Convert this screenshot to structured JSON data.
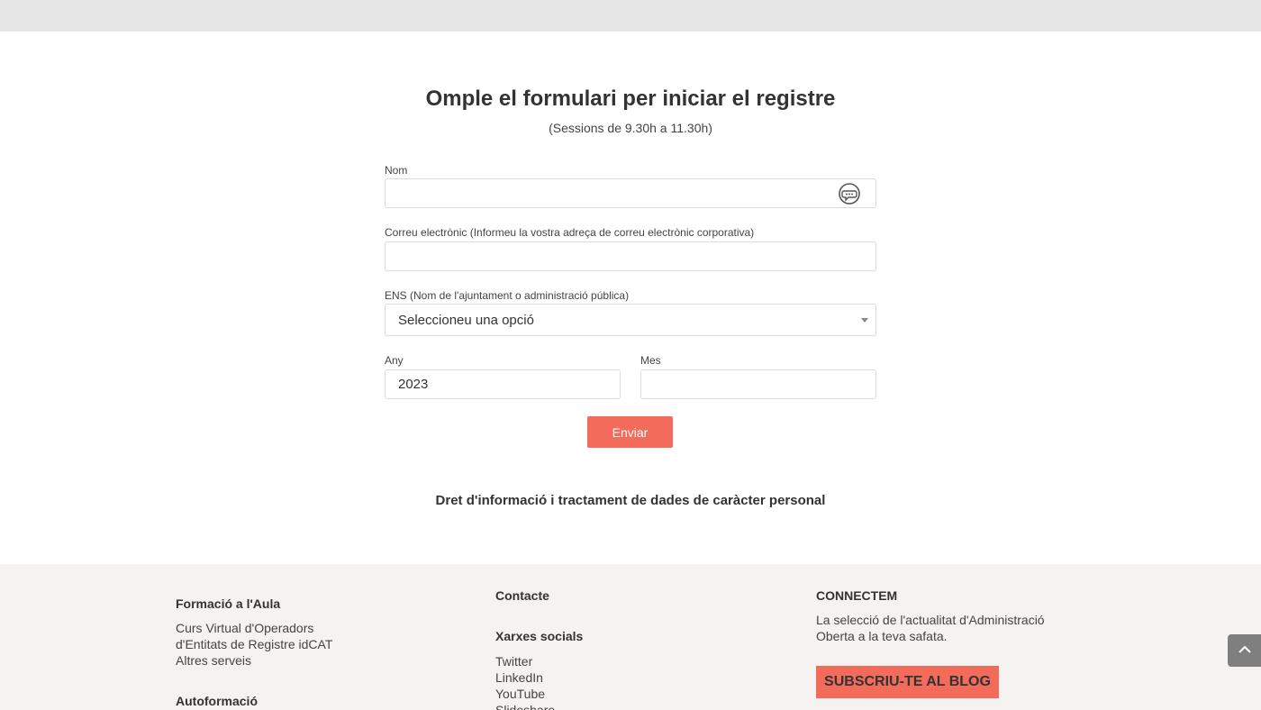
{
  "form": {
    "title": "Omple el formulari per iniciar el registre",
    "subtitle": "(Sessions de 9.30h a 11.30h)",
    "name_label": "Nom",
    "name_value": "",
    "email_label": "Correu electrònic (Informeu la vostra adreça de correu electrònic corporativa)",
    "email_value": "",
    "ens_label": "ENS (Nom de l'ajuntament o administració pública)",
    "ens_selected": "Seleccioneu una opció",
    "year_label": "Any",
    "year_value": "2023",
    "month_label": "Mes",
    "month_value": "",
    "submit_label": "Enviar"
  },
  "privacy_link": "Dret d'informació i tractament de dades de caràcter personal",
  "footer": {
    "col1": {
      "heading": "Formació a l'Aula",
      "links": [
        "Curs Virtual d'Operadors",
        "d'Entitats de Registre idCAT",
        "Altres serveis"
      ],
      "heading2": "Autoformació"
    },
    "col2": {
      "heading": "Contacte",
      "social_heading": "Xarxes socials",
      "links": [
        "Twitter",
        "LinkedIn",
        "YouTube",
        "Slideshare"
      ]
    },
    "col3": {
      "heading": "CONNECTEM",
      "text_line1": "La selecció de l'actualitat d'Administració",
      "text_line2": "Oberta a la teva safata.",
      "cta": "SUBSCRIU-TE AL BLOG"
    }
  },
  "icons": {
    "chat": "chat-bubble-icon",
    "dropdown": "chevron-down-icon",
    "back_to_top": "chevron-up-icon"
  },
  "colors": {
    "accent": "#f26b5b",
    "top_bar": "#e6e6e6",
    "footer_bg": "#f5f3f1",
    "back_to_top": "#7f7f7f"
  }
}
